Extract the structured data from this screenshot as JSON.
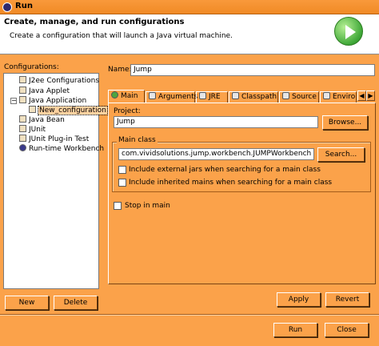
{
  "window": {
    "title": "Run"
  },
  "header": {
    "title": "Create, manage, and run configurations",
    "description": "Create a configuration that will launch a Java virtual machine."
  },
  "sidebar": {
    "label": "Configurations:",
    "tree": [
      {
        "label": "J2ee Configurations",
        "icon": "j2ee-icon"
      },
      {
        "label": "Java Applet",
        "icon": "applet-icon"
      },
      {
        "label": "Java Application",
        "icon": "java-app-icon",
        "expanded": true
      },
      {
        "label": "New_configuration",
        "icon": "config-icon",
        "selected": true
      },
      {
        "label": "Java Bean",
        "icon": "bean-icon"
      },
      {
        "label": "JUnit",
        "icon": "junit-icon"
      },
      {
        "label": "JUnit Plug-in Test",
        "icon": "junit-plugin-icon"
      },
      {
        "label": "Run-time Workbench",
        "icon": "workbench-icon"
      }
    ],
    "new_label": "New",
    "delete_label": "Delete"
  },
  "main": {
    "name_label": "Name:",
    "name_value": "Jump",
    "tabs": [
      {
        "label": "Main",
        "icon": "main-icon"
      },
      {
        "label": "Arguments",
        "icon": "arguments-icon"
      },
      {
        "label": "JRE",
        "icon": "jre-icon"
      },
      {
        "label": "Classpath",
        "icon": "classpath-icon"
      },
      {
        "label": "Source",
        "icon": "source-icon"
      },
      {
        "label": "Enviro",
        "icon": "environment-icon"
      }
    ],
    "project_label": "Project:",
    "project_value": "Jump",
    "browse_label": "Browse...",
    "main_class_group": "Main class",
    "main_class_value": "com.vividsolutions.jump.workbench.JUMPWorkbench",
    "search_label": "Search...",
    "include_external": "Include external jars when searching for a main class",
    "include_inherited": "Include inherited mains when searching for a main class",
    "stop_in_main": "Stop in main",
    "apply_label": "Apply",
    "revert_label": "Revert"
  },
  "footer": {
    "run_label": "Run",
    "close_label": "Close"
  },
  "colors": {
    "background": "#fba24a",
    "header": "#ffffff",
    "run_icon": "#3fa838"
  }
}
